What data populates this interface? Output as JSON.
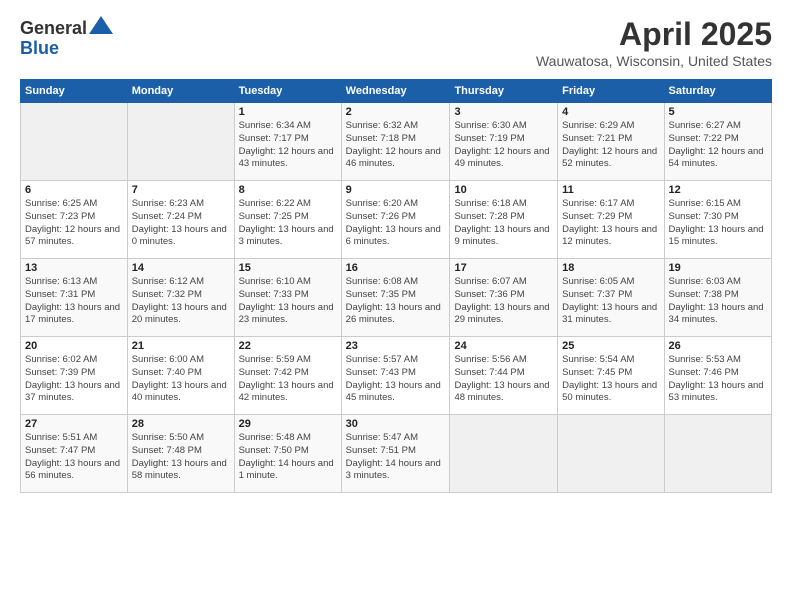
{
  "logo": {
    "general": "General",
    "blue": "Blue"
  },
  "header": {
    "month_year": "April 2025",
    "location": "Wauwatosa, Wisconsin, United States"
  },
  "weekdays": [
    "Sunday",
    "Monday",
    "Tuesday",
    "Wednesday",
    "Thursday",
    "Friday",
    "Saturday"
  ],
  "weeks": [
    [
      {
        "day": "",
        "info": ""
      },
      {
        "day": "",
        "info": ""
      },
      {
        "day": "1",
        "info": "Sunrise: 6:34 AM\nSunset: 7:17 PM\nDaylight: 12 hours and 43 minutes."
      },
      {
        "day": "2",
        "info": "Sunrise: 6:32 AM\nSunset: 7:18 PM\nDaylight: 12 hours and 46 minutes."
      },
      {
        "day": "3",
        "info": "Sunrise: 6:30 AM\nSunset: 7:19 PM\nDaylight: 12 hours and 49 minutes."
      },
      {
        "day": "4",
        "info": "Sunrise: 6:29 AM\nSunset: 7:21 PM\nDaylight: 12 hours and 52 minutes."
      },
      {
        "day": "5",
        "info": "Sunrise: 6:27 AM\nSunset: 7:22 PM\nDaylight: 12 hours and 54 minutes."
      }
    ],
    [
      {
        "day": "6",
        "info": "Sunrise: 6:25 AM\nSunset: 7:23 PM\nDaylight: 12 hours and 57 minutes."
      },
      {
        "day": "7",
        "info": "Sunrise: 6:23 AM\nSunset: 7:24 PM\nDaylight: 13 hours and 0 minutes."
      },
      {
        "day": "8",
        "info": "Sunrise: 6:22 AM\nSunset: 7:25 PM\nDaylight: 13 hours and 3 minutes."
      },
      {
        "day": "9",
        "info": "Sunrise: 6:20 AM\nSunset: 7:26 PM\nDaylight: 13 hours and 6 minutes."
      },
      {
        "day": "10",
        "info": "Sunrise: 6:18 AM\nSunset: 7:28 PM\nDaylight: 13 hours and 9 minutes."
      },
      {
        "day": "11",
        "info": "Sunrise: 6:17 AM\nSunset: 7:29 PM\nDaylight: 13 hours and 12 minutes."
      },
      {
        "day": "12",
        "info": "Sunrise: 6:15 AM\nSunset: 7:30 PM\nDaylight: 13 hours and 15 minutes."
      }
    ],
    [
      {
        "day": "13",
        "info": "Sunrise: 6:13 AM\nSunset: 7:31 PM\nDaylight: 13 hours and 17 minutes."
      },
      {
        "day": "14",
        "info": "Sunrise: 6:12 AM\nSunset: 7:32 PM\nDaylight: 13 hours and 20 minutes."
      },
      {
        "day": "15",
        "info": "Sunrise: 6:10 AM\nSunset: 7:33 PM\nDaylight: 13 hours and 23 minutes."
      },
      {
        "day": "16",
        "info": "Sunrise: 6:08 AM\nSunset: 7:35 PM\nDaylight: 13 hours and 26 minutes."
      },
      {
        "day": "17",
        "info": "Sunrise: 6:07 AM\nSunset: 7:36 PM\nDaylight: 13 hours and 29 minutes."
      },
      {
        "day": "18",
        "info": "Sunrise: 6:05 AM\nSunset: 7:37 PM\nDaylight: 13 hours and 31 minutes."
      },
      {
        "day": "19",
        "info": "Sunrise: 6:03 AM\nSunset: 7:38 PM\nDaylight: 13 hours and 34 minutes."
      }
    ],
    [
      {
        "day": "20",
        "info": "Sunrise: 6:02 AM\nSunset: 7:39 PM\nDaylight: 13 hours and 37 minutes."
      },
      {
        "day": "21",
        "info": "Sunrise: 6:00 AM\nSunset: 7:40 PM\nDaylight: 13 hours and 40 minutes."
      },
      {
        "day": "22",
        "info": "Sunrise: 5:59 AM\nSunset: 7:42 PM\nDaylight: 13 hours and 42 minutes."
      },
      {
        "day": "23",
        "info": "Sunrise: 5:57 AM\nSunset: 7:43 PM\nDaylight: 13 hours and 45 minutes."
      },
      {
        "day": "24",
        "info": "Sunrise: 5:56 AM\nSunset: 7:44 PM\nDaylight: 13 hours and 48 minutes."
      },
      {
        "day": "25",
        "info": "Sunrise: 5:54 AM\nSunset: 7:45 PM\nDaylight: 13 hours and 50 minutes."
      },
      {
        "day": "26",
        "info": "Sunrise: 5:53 AM\nSunset: 7:46 PM\nDaylight: 13 hours and 53 minutes."
      }
    ],
    [
      {
        "day": "27",
        "info": "Sunrise: 5:51 AM\nSunset: 7:47 PM\nDaylight: 13 hours and 56 minutes."
      },
      {
        "day": "28",
        "info": "Sunrise: 5:50 AM\nSunset: 7:48 PM\nDaylight: 13 hours and 58 minutes."
      },
      {
        "day": "29",
        "info": "Sunrise: 5:48 AM\nSunset: 7:50 PM\nDaylight: 14 hours and 1 minute."
      },
      {
        "day": "30",
        "info": "Sunrise: 5:47 AM\nSunset: 7:51 PM\nDaylight: 14 hours and 3 minutes."
      },
      {
        "day": "",
        "info": ""
      },
      {
        "day": "",
        "info": ""
      },
      {
        "day": "",
        "info": ""
      }
    ]
  ]
}
